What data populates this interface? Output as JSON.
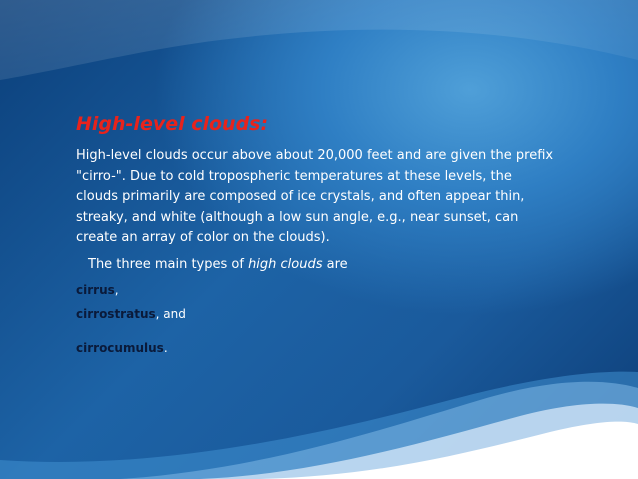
{
  "slide": {
    "title": "High-level clouds:",
    "paragraph": "High-level clouds occur above about 20,000 feet and are given the prefix \"cirro-\". Due to cold tropospheric temperatures at these levels, the clouds primarily are  composed of ice crystals,  and often appear thin, streaky, and white (although a low sun angle, e.g., near sunset, can create an array  of color on the clouds).",
    "intro_prefix": "The three main types of ",
    "intro_emphasis": "high clouds",
    "intro_suffix": " are",
    "types": [
      {
        "name": "cirrus",
        "suffix": ","
      },
      {
        "name": "cirrostratus",
        "suffix": ", and"
      },
      {
        "name": "cirrocumulus",
        "suffix": "."
      }
    ]
  },
  "colors": {
    "title": "#e8231c",
    "text": "#ffffff",
    "type_names": "#0a1a3a",
    "background_dark": "#0b3f7a",
    "background_light": "#4f9fd8"
  }
}
